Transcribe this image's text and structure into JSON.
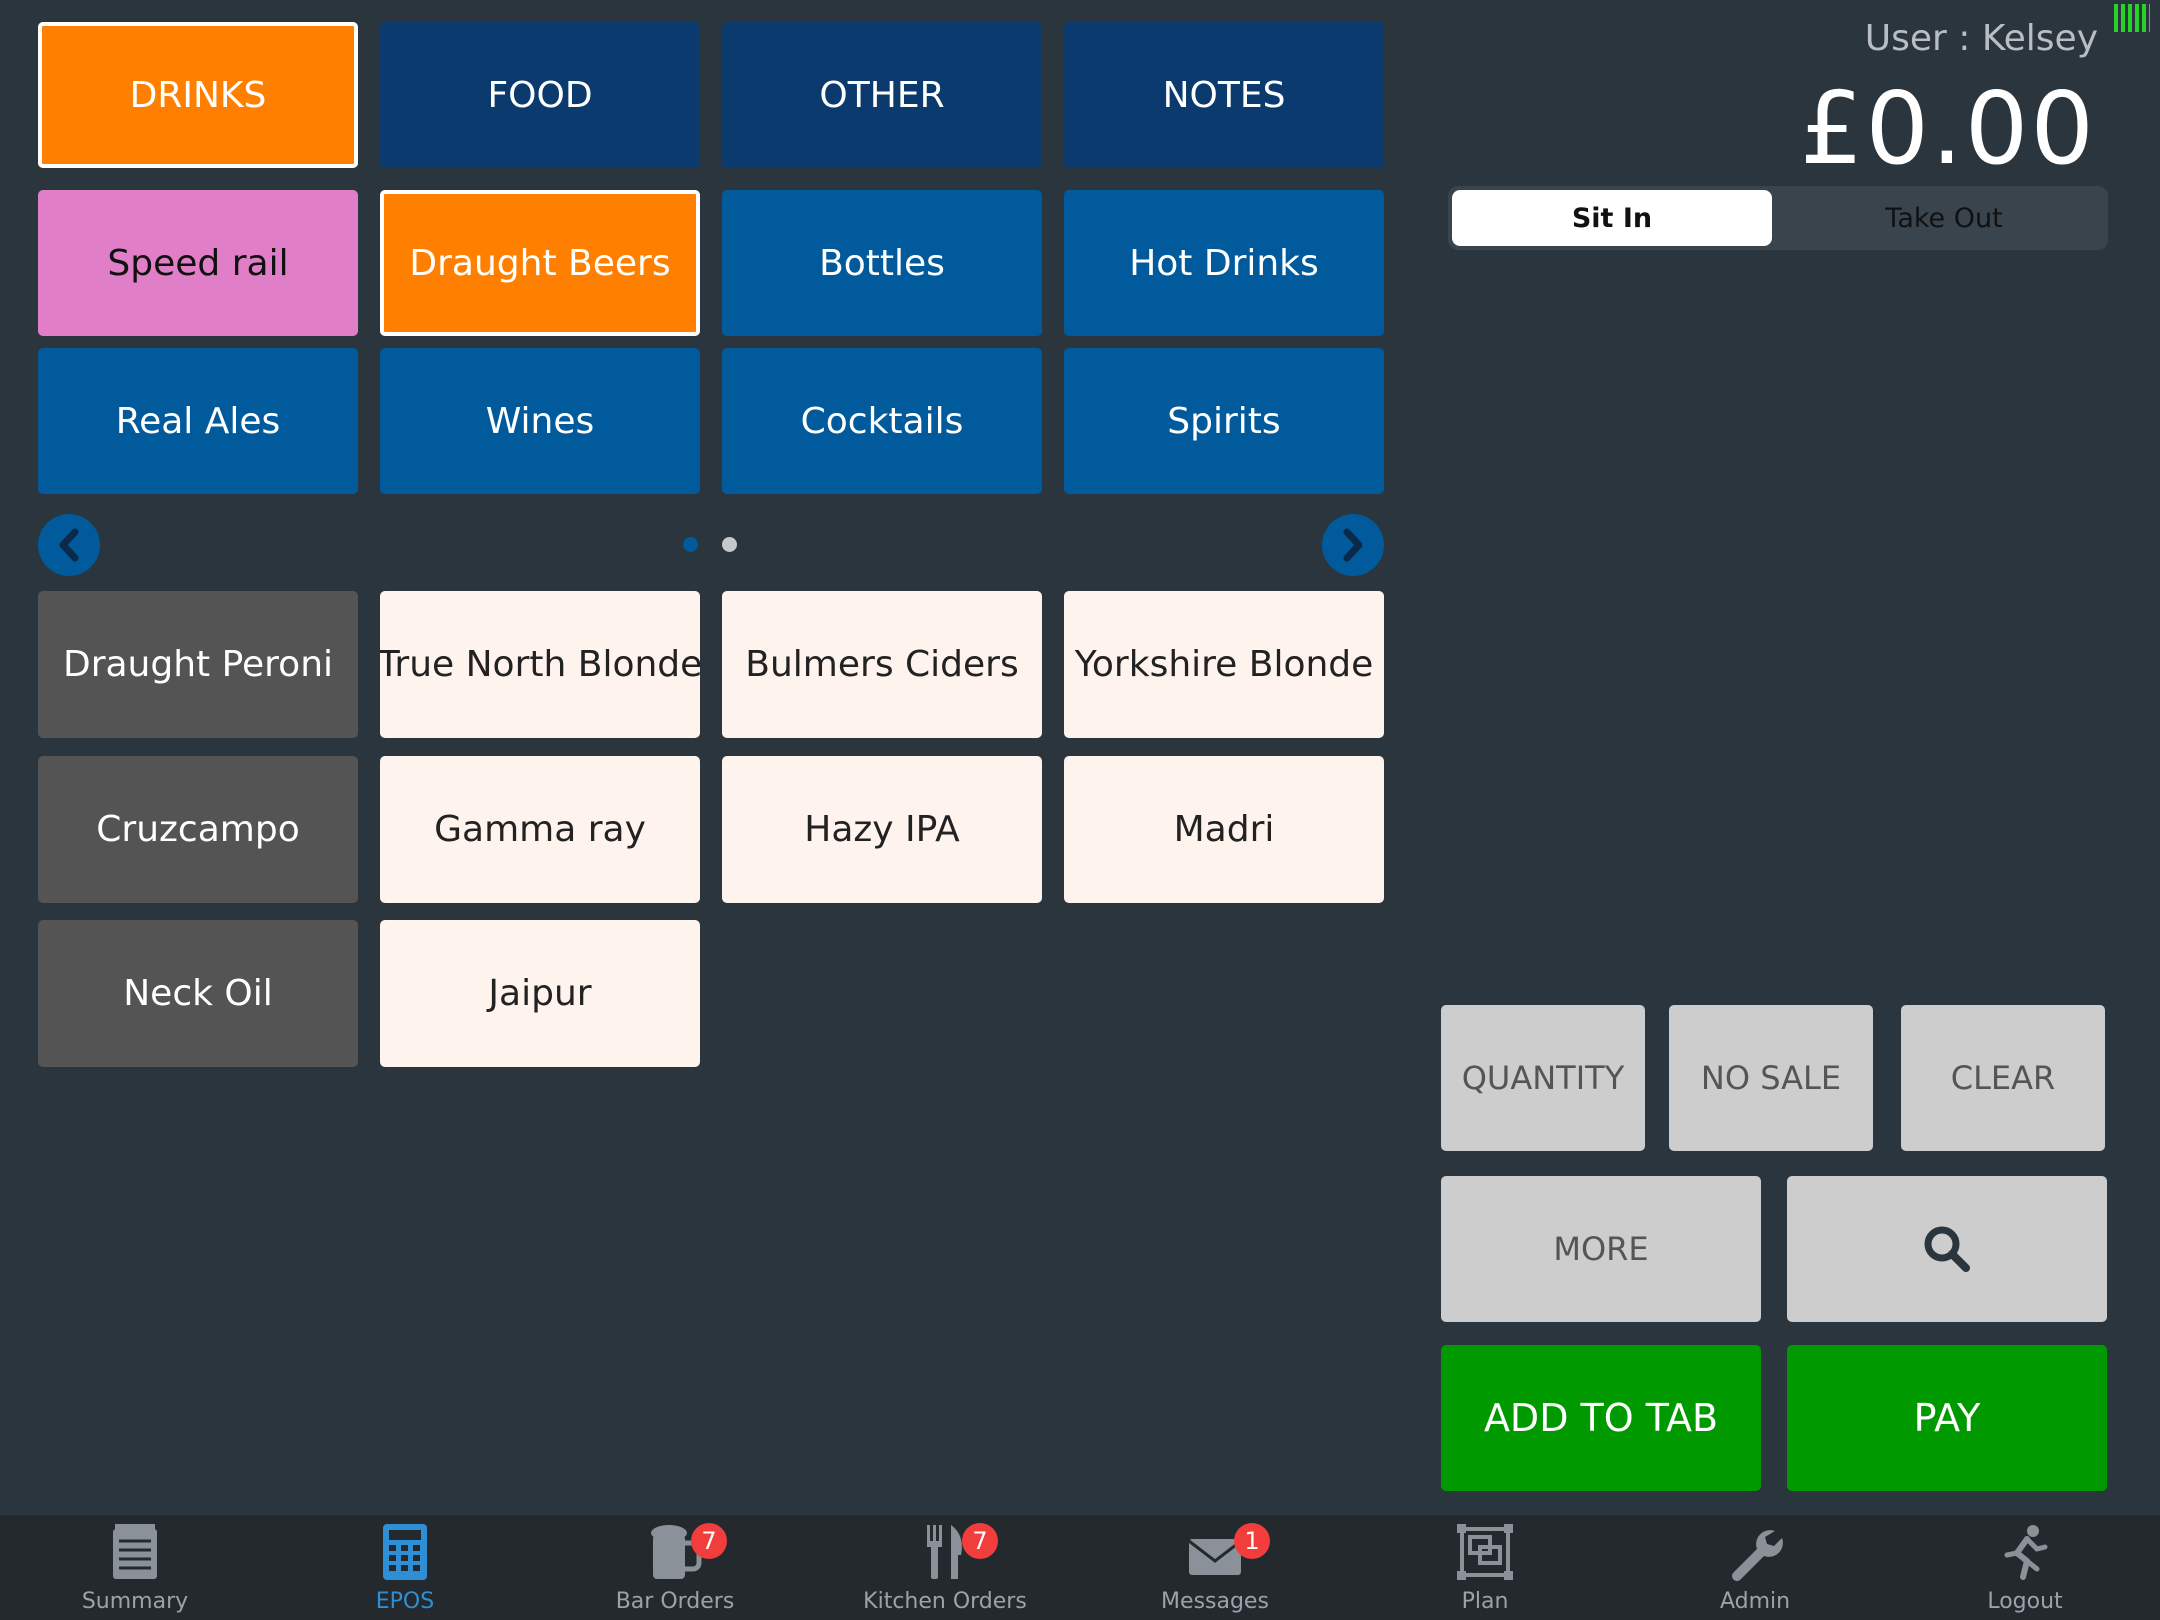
{
  "header": {
    "user": "User : Kelsey",
    "total": "£0.00"
  },
  "order_mode": {
    "sit_in": "Sit In",
    "take_out": "Take Out",
    "selected": "Sit In"
  },
  "top_categories": [
    "DRINKS",
    "FOOD",
    "OTHER",
    "NOTES"
  ],
  "sub_categories": [
    "Speed rail",
    "Draught Beers",
    "Bottles",
    "Hot Drinks",
    "Real Ales",
    "Wines",
    "Cocktails",
    "Spirits"
  ],
  "pager": {
    "pages": 2,
    "current": 1
  },
  "items": [
    "Draught Peroni",
    "True North Blonde",
    "Bulmers Ciders",
    "Yorkshire Blonde",
    "Cruzcampo",
    "Gamma ray",
    "Hazy IPA",
    "Madri",
    "Neck Oil",
    "Jaipur"
  ],
  "functions": {
    "quantity": "QUANTITY",
    "no_sale": "NO SALE",
    "clear": "CLEAR",
    "more": "MORE",
    "add_to_tab": "ADD TO TAB",
    "pay": "PAY"
  },
  "tabs": [
    {
      "label": "Summary",
      "icon": "summary-icon"
    },
    {
      "label": "EPOS",
      "icon": "calculator-icon"
    },
    {
      "label": "Bar Orders",
      "icon": "beer-mug-icon",
      "badge": "7"
    },
    {
      "label": "Kitchen Orders",
      "icon": "cutlery-icon",
      "badge": "7"
    },
    {
      "label": "Messages",
      "icon": "envelope-icon",
      "badge": "1"
    },
    {
      "label": "Plan",
      "icon": "floor-plan-icon"
    },
    {
      "label": "Admin",
      "icon": "wrench-icon"
    },
    {
      "label": "Logout",
      "icon": "running-person-icon"
    }
  ],
  "colors": {
    "background": "#2b353d",
    "selected": "#ff8000",
    "category_dark": "#0b3a6e",
    "category": "#005a9c",
    "speed_rail": "#e07fc8",
    "item_grey": "#545454",
    "item_cream": "#fff3ee",
    "function": "#cdcdcd",
    "pay_green": "#009a00",
    "active_tab": "#2e8fd6",
    "badge": "#f23d3d"
  }
}
